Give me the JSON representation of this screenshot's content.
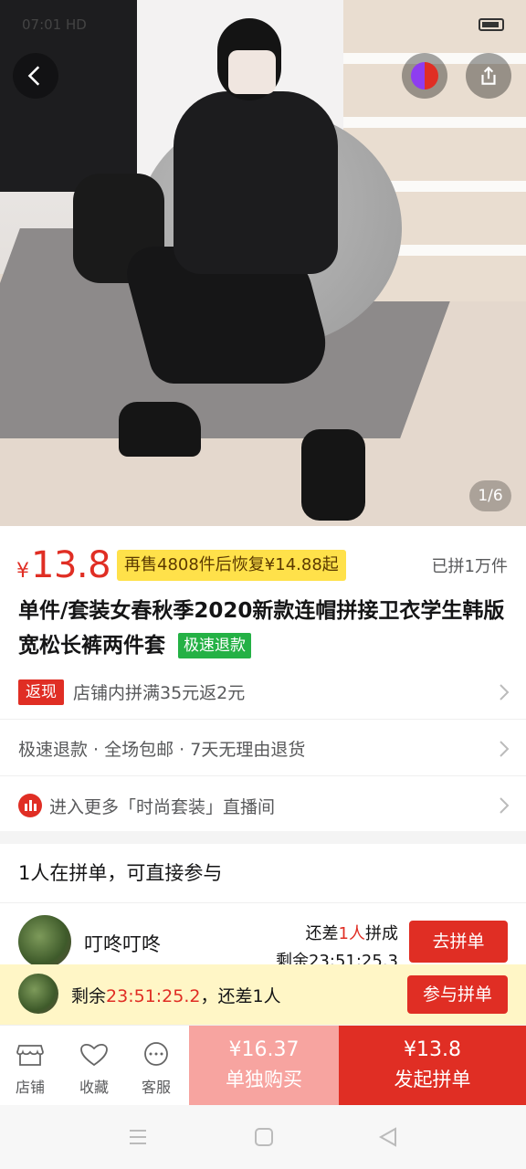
{
  "status_bar": {
    "time": "07:01",
    "network": "HD"
  },
  "gallery": {
    "counter": "1/6"
  },
  "price": {
    "currency": "¥",
    "value": "13.8",
    "resale_note": "再售4808件后恢复¥14.88起",
    "sold": "已拼1万件"
  },
  "product": {
    "title": "单件/套装女春秋季2020新款连帽拼接卫衣学生韩版宽松长裤两件套",
    "refund_tag": "极速退款"
  },
  "cashback": {
    "badge": "返现",
    "text": "店铺内拼满35元返2元"
  },
  "services": {
    "text": "极速退款 · 全场包邮 · 7天无理由退货"
  },
  "live": {
    "text": "进入更多「时尚套装」直播间"
  },
  "group": {
    "header": "1人在拼单，可直接参与",
    "user": "叮咚叮咚",
    "need_prefix": "还差",
    "need_count": "1人",
    "need_suffix": "拼成",
    "remain": "剩余23:51:25.3",
    "join_label": "去拼单"
  },
  "float_bar": {
    "prefix": "剩余",
    "countdown": "23:51:25.2",
    "suffix": "，还差1人",
    "button": "参与拼单"
  },
  "bottom_bar": {
    "store": "店铺",
    "favorite": "收藏",
    "service": "客服",
    "single_price": "¥16.37",
    "single_label": "单独购买",
    "group_price": "¥13.8",
    "group_label": "发起拼单"
  },
  "colors": {
    "accent": "#e02e24",
    "highlight": "#ffe14a",
    "green_tag": "#24b145"
  }
}
